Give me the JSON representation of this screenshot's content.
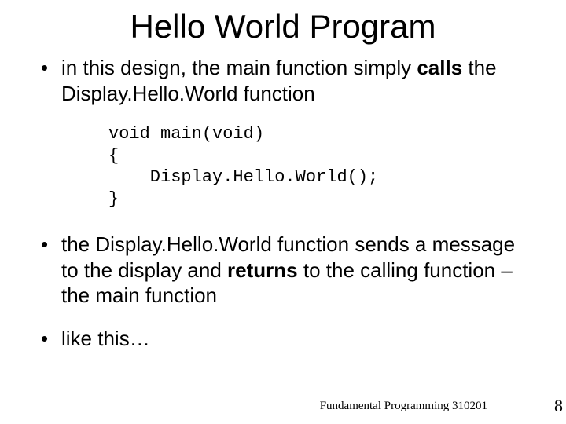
{
  "title": "Hello World Program",
  "bullets": [
    {
      "pre": "in this design, the main function simply ",
      "bold": "calls",
      "post": " the Display.Hello.World function"
    },
    {
      "pre": "the Display.Hello.World function sends a message to the display and ",
      "bold": "returns ",
      "post": " to the calling function – the main function"
    },
    {
      "pre": "like this…",
      "bold": "",
      "post": ""
    }
  ],
  "code": {
    "l1": "void main(void)",
    "l2": "{",
    "l3": "    Display.Hello.World();",
    "l4": "}"
  },
  "footer": "Fundamental Programming 310201",
  "page": "8"
}
